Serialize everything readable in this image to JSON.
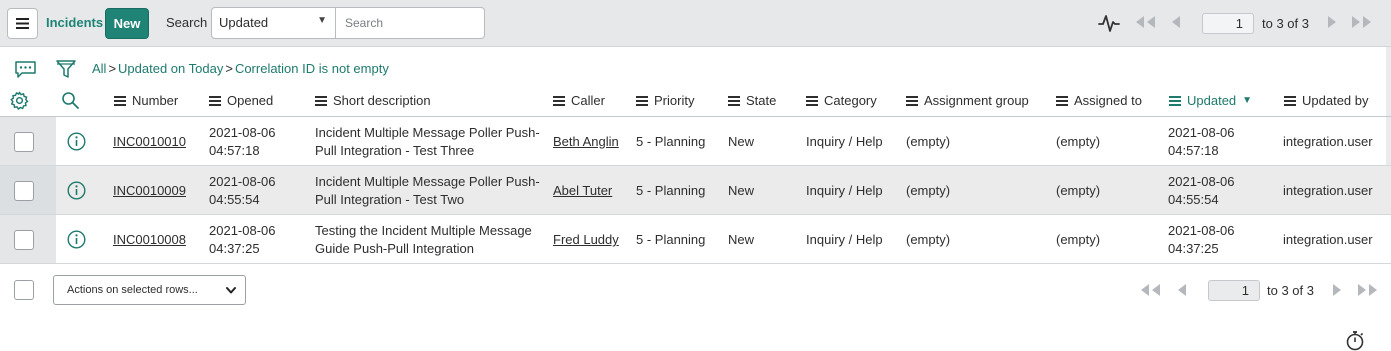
{
  "header": {
    "title": "Incidents",
    "new_label": "New",
    "search_label": "Search",
    "search_field": "Updated",
    "search_placeholder": "Search",
    "page": "1",
    "page_range": "to 3 of 3"
  },
  "breadcrumb": {
    "all": "All",
    "sep": ">",
    "item1": "Updated on Today",
    "item2": "Correlation ID is not empty"
  },
  "columns": {
    "number": "Number",
    "opened": "Opened",
    "short_description": "Short description",
    "caller": "Caller",
    "priority": "Priority",
    "state": "State",
    "category": "Category",
    "assignment_group": "Assignment group",
    "assigned_to": "Assigned to",
    "updated": "Updated",
    "updated_by": "Updated by"
  },
  "rows": [
    {
      "number": "INC0010010",
      "opened_date": "2021-08-06",
      "opened_time": "04:57:18",
      "desc_line1": "Incident Multiple Message Poller Push-",
      "desc_line2": "Pull Integration - Test Three",
      "caller": "Beth Anglin",
      "priority": "5 - Planning",
      "state": "New",
      "category": "Inquiry / Help",
      "assignment_group": "(empty)",
      "assigned_to": "(empty)",
      "updated_date": "2021-08-06",
      "updated_time": "04:57:18",
      "updated_by": "integration.user"
    },
    {
      "number": "INC0010009",
      "opened_date": "2021-08-06",
      "opened_time": "04:55:54",
      "desc_line1": "Incident Multiple Message Poller Push-",
      "desc_line2": "Pull Integration - Test Two",
      "caller": "Abel Tuter",
      "priority": "5 - Planning",
      "state": "New",
      "category": "Inquiry / Help",
      "assignment_group": "(empty)",
      "assigned_to": "(empty)",
      "updated_date": "2021-08-06",
      "updated_time": "04:55:54",
      "updated_by": "integration.user"
    },
    {
      "number": "INC0010008",
      "opened_date": "2021-08-06",
      "opened_time": "04:37:25",
      "desc_line1": "Testing the Incident Multiple Message",
      "desc_line2": "Guide Push-Pull Integration",
      "caller": "Fred Luddy",
      "priority": "5 - Planning",
      "state": "New",
      "category": "Inquiry / Help",
      "assignment_group": "(empty)",
      "assigned_to": "(empty)",
      "updated_date": "2021-08-06",
      "updated_time": "04:37:25",
      "updated_by": "integration.user"
    }
  ],
  "footer": {
    "actions_label": "Actions on selected rows...",
    "page": "1",
    "page_range": "to 3 of 3"
  },
  "colors": {
    "accent": "#1f8476",
    "link": "#1f7a6e",
    "header_bg": "#e6e8ea"
  }
}
